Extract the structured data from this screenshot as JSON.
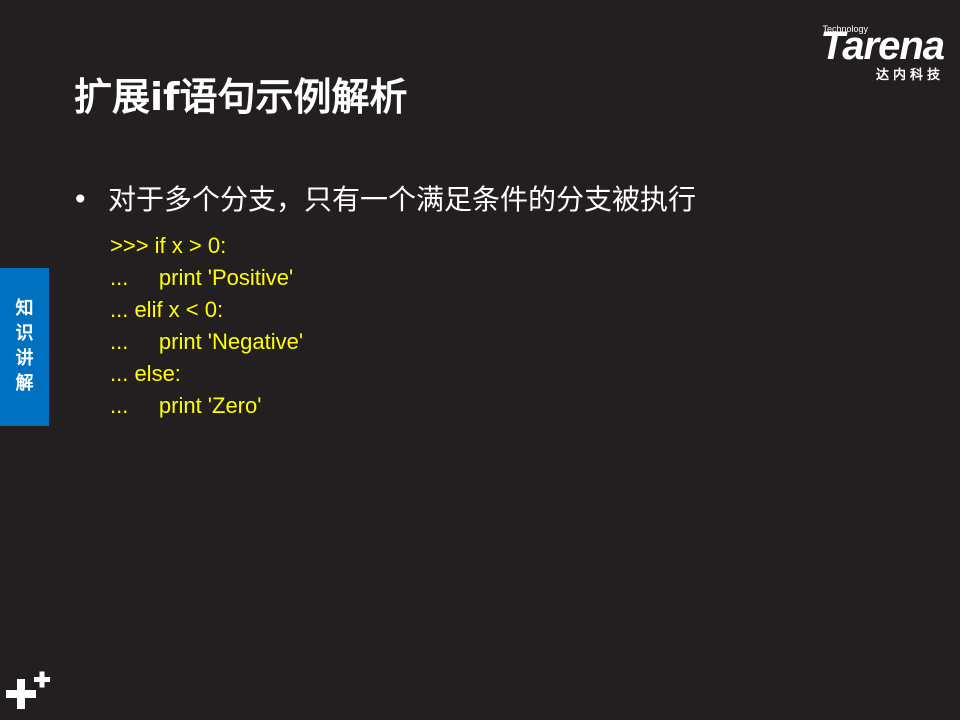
{
  "logo": {
    "tagline": "Technology",
    "brand": "Tarena",
    "chinese": "达内科技"
  },
  "slide": {
    "title": "扩展if语句示例解析",
    "bullet": "对于多个分支，只有一个满足条件的分支被执行",
    "code_lines": [
      ">>> if x > 0:",
      "...     print 'Positive'",
      "... elif x < 0:",
      "...     print 'Negative'",
      "... else:",
      "...     print 'Zero'"
    ]
  },
  "side_tab": {
    "chars": [
      "知",
      "识",
      "讲",
      "解"
    ]
  },
  "colors": {
    "background": "#231f20",
    "code": "#ffff00",
    "tab": "#0070c0",
    "text": "#ffffff"
  },
  "icons": {
    "bottom_left": "plus-plus-icon"
  }
}
